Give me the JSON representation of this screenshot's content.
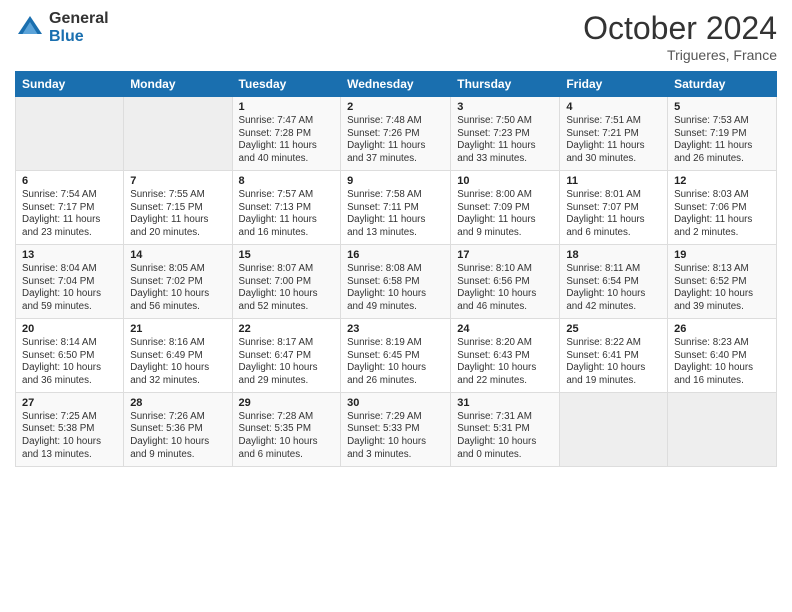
{
  "logo": {
    "general": "General",
    "blue": "Blue"
  },
  "title": "October 2024",
  "location": "Trigueres, France",
  "days_header": [
    "Sunday",
    "Monday",
    "Tuesday",
    "Wednesday",
    "Thursday",
    "Friday",
    "Saturday"
  ],
  "weeks": [
    [
      {
        "day": "",
        "empty": true
      },
      {
        "day": "",
        "empty": true
      },
      {
        "day": "1",
        "sunrise": "Sunrise: 7:47 AM",
        "sunset": "Sunset: 7:28 PM",
        "daylight": "Daylight: 11 hours and 40 minutes."
      },
      {
        "day": "2",
        "sunrise": "Sunrise: 7:48 AM",
        "sunset": "Sunset: 7:26 PM",
        "daylight": "Daylight: 11 hours and 37 minutes."
      },
      {
        "day": "3",
        "sunrise": "Sunrise: 7:50 AM",
        "sunset": "Sunset: 7:23 PM",
        "daylight": "Daylight: 11 hours and 33 minutes."
      },
      {
        "day": "4",
        "sunrise": "Sunrise: 7:51 AM",
        "sunset": "Sunset: 7:21 PM",
        "daylight": "Daylight: 11 hours and 30 minutes."
      },
      {
        "day": "5",
        "sunrise": "Sunrise: 7:53 AM",
        "sunset": "Sunset: 7:19 PM",
        "daylight": "Daylight: 11 hours and 26 minutes."
      }
    ],
    [
      {
        "day": "6",
        "sunrise": "Sunrise: 7:54 AM",
        "sunset": "Sunset: 7:17 PM",
        "daylight": "Daylight: 11 hours and 23 minutes."
      },
      {
        "day": "7",
        "sunrise": "Sunrise: 7:55 AM",
        "sunset": "Sunset: 7:15 PM",
        "daylight": "Daylight: 11 hours and 20 minutes."
      },
      {
        "day": "8",
        "sunrise": "Sunrise: 7:57 AM",
        "sunset": "Sunset: 7:13 PM",
        "daylight": "Daylight: 11 hours and 16 minutes."
      },
      {
        "day": "9",
        "sunrise": "Sunrise: 7:58 AM",
        "sunset": "Sunset: 7:11 PM",
        "daylight": "Daylight: 11 hours and 13 minutes."
      },
      {
        "day": "10",
        "sunrise": "Sunrise: 8:00 AM",
        "sunset": "Sunset: 7:09 PM",
        "daylight": "Daylight: 11 hours and 9 minutes."
      },
      {
        "day": "11",
        "sunrise": "Sunrise: 8:01 AM",
        "sunset": "Sunset: 7:07 PM",
        "daylight": "Daylight: 11 hours and 6 minutes."
      },
      {
        "day": "12",
        "sunrise": "Sunrise: 8:03 AM",
        "sunset": "Sunset: 7:06 PM",
        "daylight": "Daylight: 11 hours and 2 minutes."
      }
    ],
    [
      {
        "day": "13",
        "sunrise": "Sunrise: 8:04 AM",
        "sunset": "Sunset: 7:04 PM",
        "daylight": "Daylight: 10 hours and 59 minutes."
      },
      {
        "day": "14",
        "sunrise": "Sunrise: 8:05 AM",
        "sunset": "Sunset: 7:02 PM",
        "daylight": "Daylight: 10 hours and 56 minutes."
      },
      {
        "day": "15",
        "sunrise": "Sunrise: 8:07 AM",
        "sunset": "Sunset: 7:00 PM",
        "daylight": "Daylight: 10 hours and 52 minutes."
      },
      {
        "day": "16",
        "sunrise": "Sunrise: 8:08 AM",
        "sunset": "Sunset: 6:58 PM",
        "daylight": "Daylight: 10 hours and 49 minutes."
      },
      {
        "day": "17",
        "sunrise": "Sunrise: 8:10 AM",
        "sunset": "Sunset: 6:56 PM",
        "daylight": "Daylight: 10 hours and 46 minutes."
      },
      {
        "day": "18",
        "sunrise": "Sunrise: 8:11 AM",
        "sunset": "Sunset: 6:54 PM",
        "daylight": "Daylight: 10 hours and 42 minutes."
      },
      {
        "day": "19",
        "sunrise": "Sunrise: 8:13 AM",
        "sunset": "Sunset: 6:52 PM",
        "daylight": "Daylight: 10 hours and 39 minutes."
      }
    ],
    [
      {
        "day": "20",
        "sunrise": "Sunrise: 8:14 AM",
        "sunset": "Sunset: 6:50 PM",
        "daylight": "Daylight: 10 hours and 36 minutes."
      },
      {
        "day": "21",
        "sunrise": "Sunrise: 8:16 AM",
        "sunset": "Sunset: 6:49 PM",
        "daylight": "Daylight: 10 hours and 32 minutes."
      },
      {
        "day": "22",
        "sunrise": "Sunrise: 8:17 AM",
        "sunset": "Sunset: 6:47 PM",
        "daylight": "Daylight: 10 hours and 29 minutes."
      },
      {
        "day": "23",
        "sunrise": "Sunrise: 8:19 AM",
        "sunset": "Sunset: 6:45 PM",
        "daylight": "Daylight: 10 hours and 26 minutes."
      },
      {
        "day": "24",
        "sunrise": "Sunrise: 8:20 AM",
        "sunset": "Sunset: 6:43 PM",
        "daylight": "Daylight: 10 hours and 22 minutes."
      },
      {
        "day": "25",
        "sunrise": "Sunrise: 8:22 AM",
        "sunset": "Sunset: 6:41 PM",
        "daylight": "Daylight: 10 hours and 19 minutes."
      },
      {
        "day": "26",
        "sunrise": "Sunrise: 8:23 AM",
        "sunset": "Sunset: 6:40 PM",
        "daylight": "Daylight: 10 hours and 16 minutes."
      }
    ],
    [
      {
        "day": "27",
        "sunrise": "Sunrise: 7:25 AM",
        "sunset": "Sunset: 5:38 PM",
        "daylight": "Daylight: 10 hours and 13 minutes."
      },
      {
        "day": "28",
        "sunrise": "Sunrise: 7:26 AM",
        "sunset": "Sunset: 5:36 PM",
        "daylight": "Daylight: 10 hours and 9 minutes."
      },
      {
        "day": "29",
        "sunrise": "Sunrise: 7:28 AM",
        "sunset": "Sunset: 5:35 PM",
        "daylight": "Daylight: 10 hours and 6 minutes."
      },
      {
        "day": "30",
        "sunrise": "Sunrise: 7:29 AM",
        "sunset": "Sunset: 5:33 PM",
        "daylight": "Daylight: 10 hours and 3 minutes."
      },
      {
        "day": "31",
        "sunrise": "Sunrise: 7:31 AM",
        "sunset": "Sunset: 5:31 PM",
        "daylight": "Daylight: 10 hours and 0 minutes."
      },
      {
        "day": "",
        "empty": true
      },
      {
        "day": "",
        "empty": true
      }
    ]
  ]
}
